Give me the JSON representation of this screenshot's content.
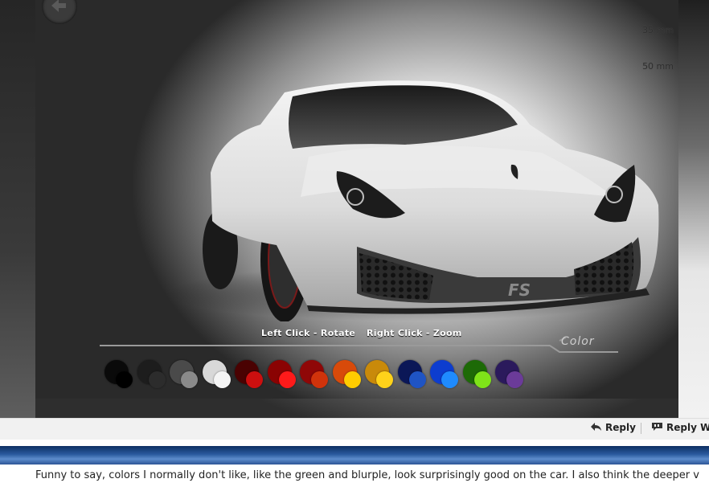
{
  "viewer": {
    "focal_lengths": [
      "35 mm",
      "50 mm"
    ],
    "hint_rotate": "Left Click - Rotate",
    "hint_zoom": "Right Click - Zoom",
    "color_label": "Color",
    "badge": "FS",
    "swatches": [
      {
        "name": "black",
        "primary": "#0a0a0a",
        "accent": "#000000"
      },
      {
        "name": "dark-gray",
        "primary": "#1d1d1d",
        "accent": "#2c2c2c"
      },
      {
        "name": "gray",
        "primary": "#4a4a4a",
        "accent": "#8a8a8a"
      },
      {
        "name": "white",
        "primary": "#d8d8d8",
        "accent": "#f4f4f4"
      },
      {
        "name": "dark-red",
        "primary": "#4a0202",
        "accent": "#cc0f0f"
      },
      {
        "name": "red",
        "primary": "#8a0303",
        "accent": "#ff1a1a"
      },
      {
        "name": "crimson",
        "primary": "#8f0707",
        "accent": "#d0330b"
      },
      {
        "name": "orange",
        "primary": "#d84a0a",
        "accent": "#ffcc00"
      },
      {
        "name": "gold",
        "primary": "#c98a0a",
        "accent": "#ffd21a"
      },
      {
        "name": "navy",
        "primary": "#0b1757",
        "accent": "#1f54c4"
      },
      {
        "name": "blue",
        "primary": "#0d3dcf",
        "accent": "#1f8bff"
      },
      {
        "name": "green",
        "primary": "#1d6a07",
        "accent": "#7fe319"
      },
      {
        "name": "purple",
        "primary": "#2b1a5c",
        "accent": "#6b3b99"
      }
    ]
  },
  "post_actions": {
    "reply": "Reply",
    "reply_with_quote": "Reply Wit"
  },
  "post": {
    "text_line1": "Funny to say, colors I normally don't like, like the green and blurple, look surprisingly good on the car. I also think the deeper v",
    "text_line2": ""
  }
}
